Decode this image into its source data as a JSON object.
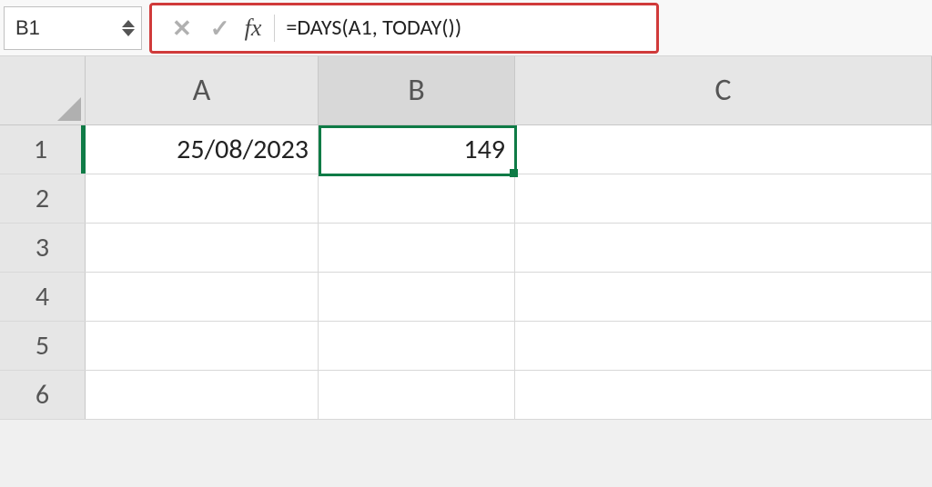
{
  "nameBox": {
    "value": "B1"
  },
  "formulaBar": {
    "fxLabel": "fx",
    "formula": "=DAYS(A1, TODAY())",
    "cancelSymbol": "✕",
    "enterSymbol": "✓"
  },
  "columns": [
    "A",
    "B",
    "C"
  ],
  "rows": [
    1,
    2,
    3,
    4,
    5,
    6
  ],
  "cells": {
    "A1": "25/08/2023",
    "B1": "149"
  },
  "selection": {
    "cell": "B1"
  }
}
